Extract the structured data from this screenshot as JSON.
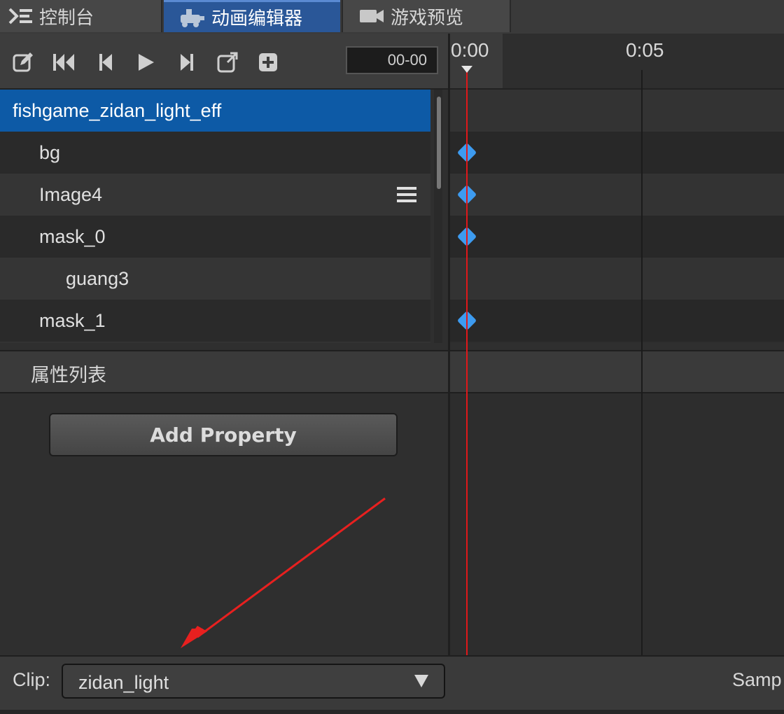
{
  "tabs": [
    {
      "label": "控制台",
      "icon": "console-icon"
    },
    {
      "label": "动画编辑器",
      "icon": "animation-editor-icon"
    },
    {
      "label": "游戏预览",
      "icon": "camera-icon"
    }
  ],
  "toolbar": {
    "buttons": [
      "edit-icon",
      "jump-to-start-icon",
      "prev-frame-icon",
      "play-icon",
      "next-frame-icon",
      "open-external-icon",
      "add-event-icon"
    ],
    "time_value": "00-00"
  },
  "ruler": {
    "ticks": [
      "0:00",
      "0:05"
    ]
  },
  "nodes": [
    {
      "name": "fishgame_zidan_light_eff",
      "selected": true,
      "keyframe": false
    },
    {
      "name": "bg",
      "keyframe": true
    },
    {
      "name": "Image4",
      "keyframe": true,
      "has_menu": true
    },
    {
      "name": "mask_0",
      "keyframe": true
    },
    {
      "name": "guang3",
      "keyframe": false
    },
    {
      "name": "mask_1",
      "keyframe": true
    }
  ],
  "properties": {
    "title": "属性列表",
    "add_button_label": "Add Property"
  },
  "clip": {
    "label": "Clip:",
    "value": "zidan_light"
  },
  "sample_label": "Samp",
  "colors": {
    "selected_row": "#0d5aa6",
    "keyframe": "#3d9bf0",
    "playhead": "#e0181a",
    "active_tab": "#2a5798",
    "annotation_arrow": "#e8201f"
  }
}
